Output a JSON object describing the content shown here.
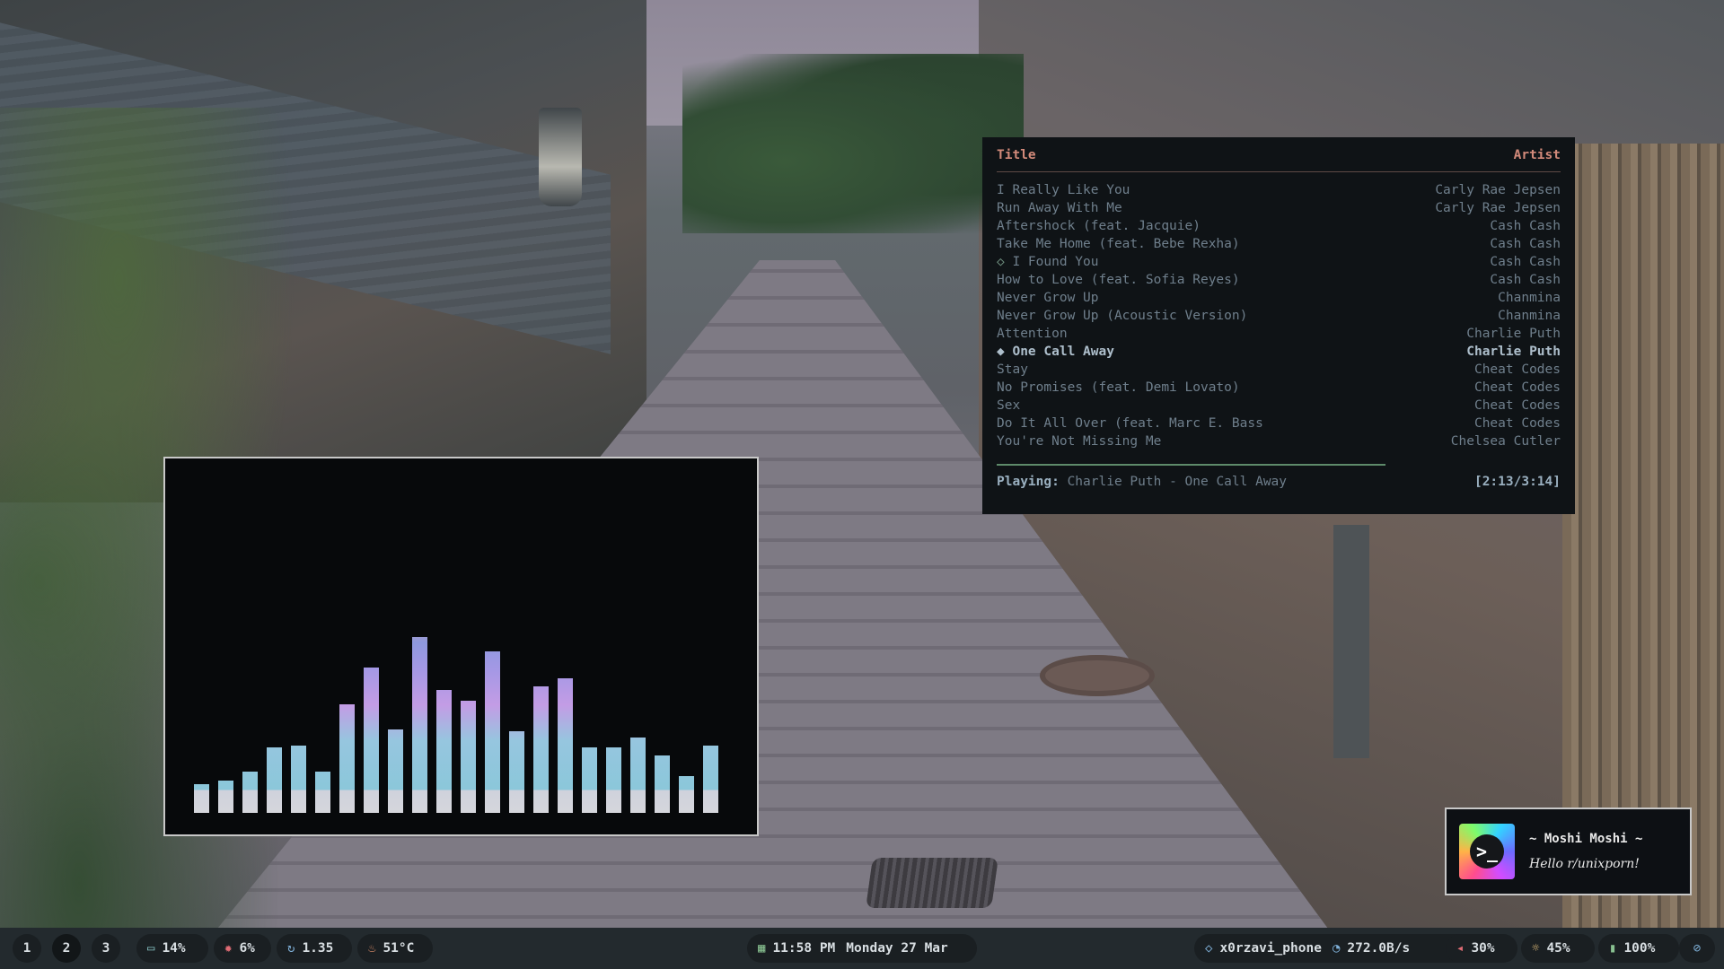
{
  "player": {
    "header": {
      "title": "Title",
      "artist": "Artist"
    },
    "tracks": [
      {
        "marker": "",
        "title": "I Really Like You",
        "artist": "Carly Rae Jepsen"
      },
      {
        "marker": "",
        "title": "Run Away With Me",
        "artist": "Carly Rae Jepsen"
      },
      {
        "marker": "",
        "title": "Aftershock (feat. Jacquie)",
        "artist": "Cash Cash"
      },
      {
        "marker": "",
        "title": "Take Me Home (feat. Bebe Rexha)",
        "artist": "Cash Cash"
      },
      {
        "marker": "◇ ",
        "title": "I Found You",
        "artist": "Cash Cash"
      },
      {
        "marker": "",
        "title": "How to Love (feat. Sofia Reyes)",
        "artist": "Cash Cash"
      },
      {
        "marker": "",
        "title": "Never Grow Up",
        "artist": "Chanmina"
      },
      {
        "marker": "",
        "title": "Never Grow Up (Acoustic Version)",
        "artist": "Chanmina"
      },
      {
        "marker": "",
        "title": "Attention",
        "artist": "Charlie Puth"
      },
      {
        "marker": "◆ ",
        "title": "One Call Away",
        "artist": "Charlie Puth"
      },
      {
        "marker": "",
        "title": "Stay",
        "artist": "Cheat Codes"
      },
      {
        "marker": "",
        "title": "No Promises (feat. Demi Lovato)",
        "artist": "Cheat Codes"
      },
      {
        "marker": "",
        "title": "Sex",
        "artist": "Cheat Codes"
      },
      {
        "marker": "",
        "title": "Do It All Over (feat. Marc E. Bass",
        "artist": "Cheat Codes"
      },
      {
        "marker": "",
        "title": "You're Not Missing Me",
        "artist": "Chelsea Cutler"
      }
    ],
    "active_index": 9,
    "status": {
      "label": "Playing:",
      "now_playing": "Charlie Puth - One Call Away",
      "time": "[2:13/3:14]"
    },
    "progress_fraction": 0.69
  },
  "visualizer": {
    "bar_levels": [
      0.14,
      0.16,
      0.2,
      0.32,
      0.33,
      0.2,
      0.53,
      0.71,
      0.41,
      0.86,
      0.6,
      0.55,
      0.79,
      0.4,
      0.62,
      0.66,
      0.32,
      0.32,
      0.37,
      0.28,
      0.18,
      0.33
    ]
  },
  "notification": {
    "title": "~ Moshi Moshi ~",
    "body": "Hello r/unixporn!",
    "icon": "terminal-logo-icon"
  },
  "bar": {
    "workspaces": [
      "1",
      "2",
      "3"
    ],
    "active_workspace": "2",
    "memory": {
      "icon": "memory-icon",
      "value": "14%"
    },
    "cpu": {
      "icon": "cpu-icon",
      "value": "6%"
    },
    "load": {
      "icon": "refresh-icon",
      "value": "1.35"
    },
    "temp": {
      "icon": "flame-icon",
      "value": "51°C"
    },
    "clock": {
      "icon": "calendar-icon",
      "time": "11:58 PM",
      "date": "Monday 27 Mar"
    },
    "wifi": {
      "icon": "wifi-icon",
      "ssid": "x0rzavi_phone"
    },
    "net": {
      "icon": "speed-icon",
      "value": "272.0B/s"
    },
    "volume": {
      "icon": "speaker-icon",
      "value": "30%"
    },
    "brightness": {
      "icon": "sun-icon",
      "value": "45%"
    },
    "battery": {
      "icon": "battery-icon",
      "value": "100%"
    },
    "bluetooth": {
      "icon": "bluetooth-off-icon"
    }
  }
}
